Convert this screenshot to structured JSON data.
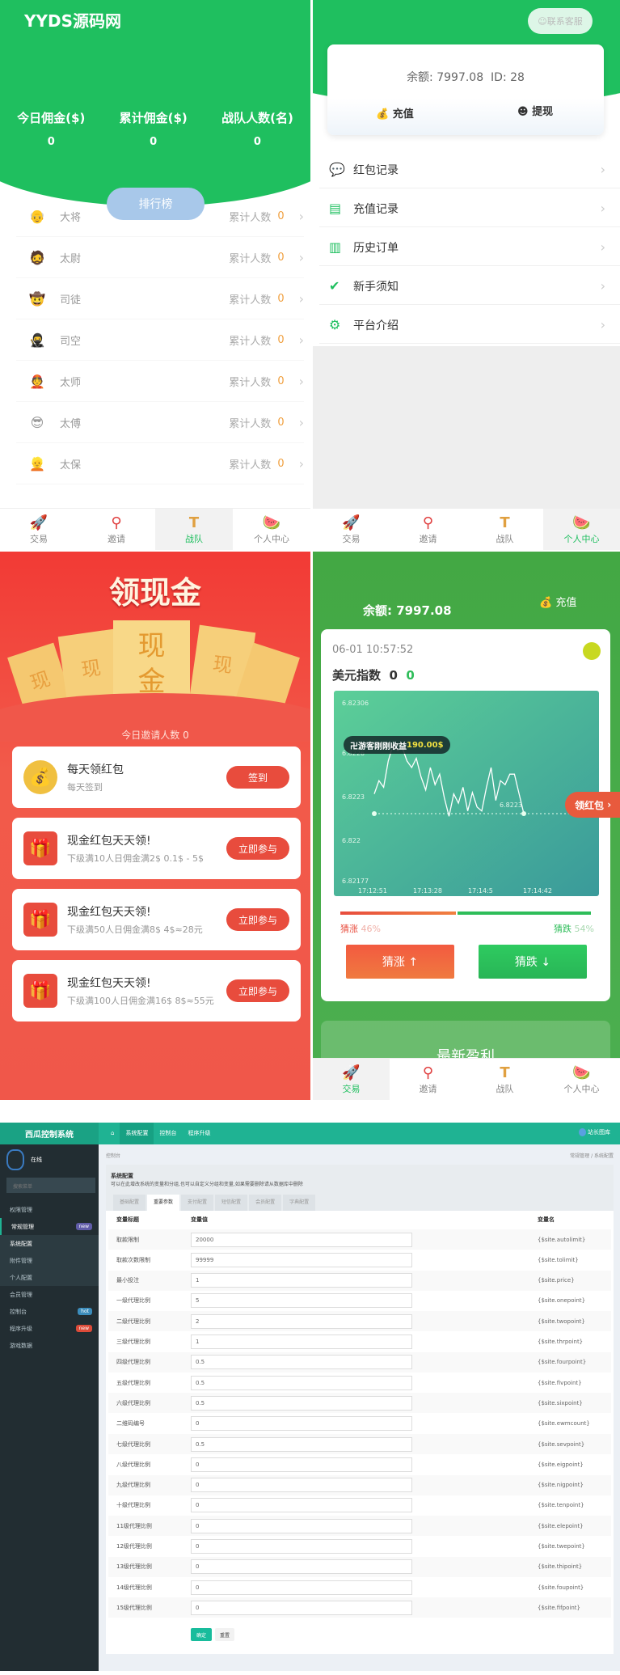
{
  "team": {
    "site_title": "YYDS源码网",
    "stats": [
      {
        "label": "今日佣金($)",
        "value": "0"
      },
      {
        "label": "累计佣金($)",
        "value": "0"
      },
      {
        "label": "战队人数(名)",
        "value": "0"
      }
    ],
    "ranking_button": "排行榜",
    "ranks": [
      {
        "name": "大将",
        "count_label": "累计人数",
        "count": "0",
        "icon": "👴"
      },
      {
        "name": "太尉",
        "count_label": "累计人数",
        "count": "0",
        "icon": "🧔"
      },
      {
        "name": "司徒",
        "count_label": "累计人数",
        "count": "0",
        "icon": "🤠"
      },
      {
        "name": "司空",
        "count_label": "累计人数",
        "count": "0",
        "icon": "🥷"
      },
      {
        "name": "太师",
        "count_label": "累计人数",
        "count": "0",
        "icon": "👲"
      },
      {
        "name": "太傅",
        "count_label": "累计人数",
        "count": "0",
        "icon": "😎"
      },
      {
        "name": "太保",
        "count_label": "累计人数",
        "count": "0",
        "icon": "👱"
      }
    ]
  },
  "tabs": [
    {
      "label": "交易",
      "icon": "🚀"
    },
    {
      "label": "邀请",
      "icon": "⚲"
    },
    {
      "label": "战队",
      "icon": "T"
    },
    {
      "label": "个人中心",
      "icon": "🍉"
    }
  ],
  "profile": {
    "support_button": "联系客服",
    "balance": "余额: 7997.08",
    "id": "ID: 28",
    "recharge": "充值",
    "withdraw": "提现",
    "menu": [
      {
        "label": "红包记录",
        "icon": "💬"
      },
      {
        "label": "充值记录",
        "icon": "▤"
      },
      {
        "label": "历史订单",
        "icon": "▥"
      },
      {
        "label": "新手须知",
        "icon": "✔"
      },
      {
        "label": "平台介绍",
        "icon": "⚙"
      }
    ]
  },
  "cash": {
    "title": "领现金",
    "ticket_chars": [
      "现",
      "金",
      "现",
      "现",
      "现"
    ],
    "invite_today": "今日邀请人数 0",
    "cards": [
      {
        "title": "每天领红包",
        "desc": "每天签到",
        "button": "签到",
        "icon": "💰"
      },
      {
        "title": "现金红包天天领!",
        "desc": "下级满10人日佣金满2$ 0.1$ - 5$",
        "button": "立即参与",
        "icon": "🎁"
      },
      {
        "title": "现金红包天天领!",
        "desc": "下级满50人日佣金满8$ 4$≈28元",
        "button": "立即参与",
        "icon": "🎁"
      },
      {
        "title": "现金红包天天领!",
        "desc": "下级满100人日佣金满16$ 8$≈55元",
        "button": "立即参与",
        "icon": "🎁"
      }
    ]
  },
  "trade": {
    "balance": "余额: 7997.08",
    "recharge": "充值",
    "datetime": "06-01 10:57:52",
    "symbol": "美元指数",
    "price": "0",
    "change": "0",
    "profit_banner": "游客刚刚收益",
    "profit_amount": "190.00$",
    "red_packet_tab": "领红包",
    "current_label": "6.8223",
    "rise_label": "猜涨",
    "rise_pct": "46%",
    "fall_label": "猜跌",
    "fall_pct": "54%",
    "rise_pct_value": 46,
    "rise_button": "猜涨 ↑",
    "fall_button": "猜跌 ↓",
    "latest_profit": "最新盈利",
    "chart": {
      "y_ticks": [
        "6.82306",
        "6.8226",
        "6.8223",
        "6.822",
        "6.82177"
      ],
      "x_ticks": [
        "17:12:51",
        "17:13:28",
        "17:14:5",
        "17:14:42"
      ],
      "ylim": [
        6.82177,
        6.82306
      ],
      "values": [
        6.82235,
        6.82245,
        6.8224,
        6.8226,
        6.82272,
        6.82268,
        6.8227,
        6.8226,
        6.82255,
        6.82262,
        6.82248,
        6.82238,
        6.82255,
        6.82242,
        6.8225,
        6.82232,
        6.82218,
        6.82235,
        6.82228,
        6.8224,
        6.82222,
        6.82236,
        6.82225,
        6.82222,
        6.8224,
        6.82255,
        6.8223,
        6.82245,
        6.82242,
        6.8225,
        6.8225,
        6.82235,
        6.8222
      ],
      "current": 6.8222
    },
    "colors": {
      "rise": "#e84c3d",
      "fall": "#2ebd59"
    }
  },
  "admin": {
    "brand": "西瓜控制系统",
    "nav": [
      "⌂",
      "系统配置",
      "控制台",
      "程序升级"
    ],
    "user": "站长图库",
    "online": "在线",
    "search_placeholder": "搜索菜单",
    "sidebar": [
      {
        "label": "权限管理"
      },
      {
        "label": "常规管理",
        "badge": "new",
        "badge_color": "#605ca8"
      },
      {
        "label": "系统配置",
        "active": true
      },
      {
        "label": "附件管理"
      },
      {
        "label": "个人配置"
      },
      {
        "label": "会员管理"
      },
      {
        "label": "控制台",
        "badge": "hot",
        "badge_color": "#3c8dbc"
      },
      {
        "label": "程序升级",
        "badge": "new",
        "badge_color": "#dd4b39"
      },
      {
        "label": "游戏数据"
      }
    ],
    "breadcrumb_left": "控制台",
    "breadcrumb_right": "常规管理 / 系统配置",
    "section_title": "系统配置",
    "section_desc": "可以在此增改系统的变量和分组,也可以自定义分组和变量,如果需要删除请从数据库中删除",
    "tabs": [
      "基础配置",
      "重要参数",
      "支付配置",
      "短信配置",
      "会员配置",
      "字典配置"
    ],
    "active_tab": 1,
    "columns": [
      "变量标题",
      "变量值",
      "变量名"
    ],
    "rows": [
      [
        "取款限制",
        "20000",
        "{$site.autolimit}"
      ],
      [
        "取款次数限制",
        "99999",
        "{$site.tolimit}"
      ],
      [
        "最小投注",
        "1",
        "{$site.price}"
      ],
      [
        "一级代理比例",
        "5",
        "{$site.onepoint}"
      ],
      [
        "二级代理比例",
        "2",
        "{$site.twopoint}"
      ],
      [
        "三级代理比例",
        "1",
        "{$site.thrpoint}"
      ],
      [
        "四级代理比例",
        "0.5",
        "{$site.fourpoint}"
      ],
      [
        "五级代理比例",
        "0.5",
        "{$site.fivpoint}"
      ],
      [
        "六级代理比例",
        "0.5",
        "{$site.sixpoint}"
      ],
      [
        "二维码编号",
        "0",
        "{$site.ewmcount}"
      ],
      [
        "七级代理比例",
        "0.5",
        "{$site.sevpoint}"
      ],
      [
        "八级代理比例",
        "0",
        "{$site.eigpoint}"
      ],
      [
        "九级代理比例",
        "0",
        "{$site.nigpoint}"
      ],
      [
        "十级代理比例",
        "0",
        "{$site.tenpoint}"
      ],
      [
        "11级代理比例",
        "0",
        "{$site.elepoint}"
      ],
      [
        "12级代理比例",
        "0",
        "{$site.twepoint}"
      ],
      [
        "13级代理比例",
        "0",
        "{$site.thipoint}"
      ],
      [
        "14级代理比例",
        "0",
        "{$site.foupoint}"
      ],
      [
        "15级代理比例",
        "0",
        "{$site.fifpoint}"
      ]
    ],
    "submit": "确定",
    "reset": "重置"
  }
}
